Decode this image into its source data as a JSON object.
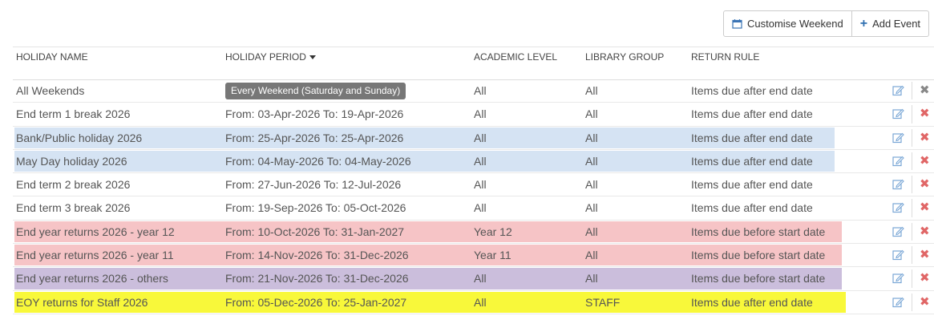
{
  "toolbar": {
    "customise_label": "Customise Weekend",
    "add_label": "Add Event"
  },
  "columns": {
    "name": "HOLIDAY NAME",
    "period": "HOLIDAY PERIOD",
    "level": "ACADEMIC LEVEL",
    "group": "LIBRARY GROUP",
    "rule": "RETURN RULE"
  },
  "colors": {
    "blue_highlight": "#d5e3f3",
    "red_highlight": "#f6c4c6",
    "purple_highlight": "#cbbedc",
    "yellow_highlight": "#f8f83a",
    "delete_red": "#e06666",
    "delete_grey": "#888888",
    "edit_blue": "#7aa7d6"
  },
  "rows": [
    {
      "name": "All Weekends",
      "period_badge": "Every Weekend (Saturday and Sunday)",
      "level": "All",
      "group": "All",
      "rule": "Items due after end date",
      "highlight": "none",
      "delete_icon": "grey"
    },
    {
      "name": "End term 1 break 2026",
      "period": "From: 03-Apr-2026  To:  19-Apr-2026",
      "level": "All",
      "group": "All",
      "rule": "Items due after end date",
      "highlight": "none",
      "delete_icon": "red"
    },
    {
      "name": "Bank/Public holiday 2026",
      "period": "From: 25-Apr-2026  To:  25-Apr-2026",
      "level": "All",
      "group": "All",
      "rule": "Items due after end date",
      "highlight": "blue",
      "delete_icon": "red"
    },
    {
      "name": "May Day holiday 2026",
      "period": "From: 04-May-2026  To:  04-May-2026",
      "level": "All",
      "group": "All",
      "rule": "Items due after end date",
      "highlight": "blue",
      "delete_icon": "red"
    },
    {
      "name": "End term 2 break 2026",
      "period": "From: 27-Jun-2026  To:  12-Jul-2026",
      "level": "All",
      "group": "All",
      "rule": "Items due after end date",
      "highlight": "none",
      "delete_icon": "red"
    },
    {
      "name": "End term 3 break 2026",
      "period": "From: 19-Sep-2026  To:  05-Oct-2026",
      "level": "All",
      "group": "All",
      "rule": "Items due after end date",
      "highlight": "none",
      "delete_icon": "red"
    },
    {
      "name": "End year returns 2026 - year 12",
      "period": "From: 10-Oct-2026  To:  31-Jan-2027",
      "level": "Year 12",
      "group": "All",
      "rule": "Items due before start date",
      "highlight": "red",
      "delete_icon": "red"
    },
    {
      "name": "End year returns 2026 - year 11",
      "period": "From: 14-Nov-2026  To:  31-Dec-2026",
      "level": "Year 11",
      "group": "All",
      "rule": "Items due before start date",
      "highlight": "red",
      "delete_icon": "red"
    },
    {
      "name": "End year returns 2026 - others",
      "period": "From: 21-Nov-2026  To:  31-Dec-2026",
      "level": "All",
      "group": "All",
      "rule": "Items due before start date",
      "highlight": "purple",
      "delete_icon": "red"
    },
    {
      "name": "EOY returns for Staff 2026",
      "period": "From: 05-Dec-2026  To:  25-Jan-2027",
      "level": "All",
      "group": "STAFF",
      "rule": "Items due after end date",
      "highlight": "yellow",
      "delete_icon": "red"
    }
  ]
}
